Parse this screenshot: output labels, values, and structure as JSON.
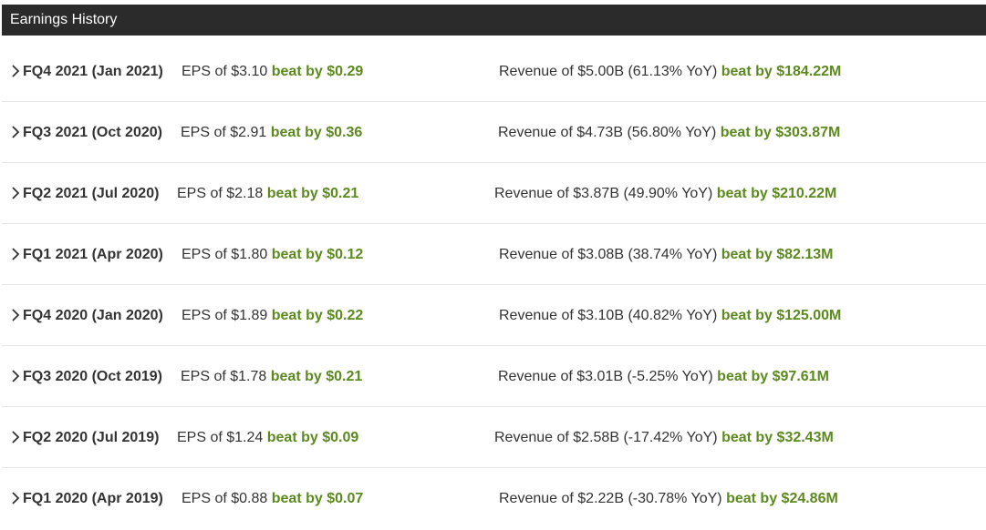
{
  "header": {
    "title": "Earnings History"
  },
  "colors": {
    "header_bg": "#2b2b2b",
    "beat_green": "#5c8a1e",
    "text": "#333333"
  },
  "rows": [
    {
      "period": "FQ4 2021 (Jan 2021)",
      "eps": "EPS of $3.10",
      "eps_beat": "beat by $0.29",
      "revenue": "Revenue of $5.00B (61.13% YoY)",
      "rev_beat": "beat by $184.22M"
    },
    {
      "period": "FQ3 2021 (Oct 2020)",
      "eps": "EPS of $2.91",
      "eps_beat": "beat by $0.36",
      "revenue": "Revenue of $4.73B (56.80% YoY)",
      "rev_beat": "beat by $303.87M"
    },
    {
      "period": "FQ2 2021 (Jul 2020)",
      "eps": "EPS of $2.18",
      "eps_beat": "beat by $0.21",
      "revenue": "Revenue of $3.87B (49.90% YoY)",
      "rev_beat": "beat by $210.22M"
    },
    {
      "period": "FQ1 2021 (Apr 2020)",
      "eps": "EPS of $1.80",
      "eps_beat": "beat by $0.12",
      "revenue": "Revenue of $3.08B (38.74% YoY)",
      "rev_beat": "beat by $82.13M"
    },
    {
      "period": "FQ4 2020 (Jan 2020)",
      "eps": "EPS of $1.89",
      "eps_beat": "beat by $0.22",
      "revenue": "Revenue of $3.10B (40.82% YoY)",
      "rev_beat": "beat by $125.00M"
    },
    {
      "period": "FQ3 2020 (Oct 2019)",
      "eps": "EPS of $1.78",
      "eps_beat": "beat by $0.21",
      "revenue": "Revenue of $3.01B (-5.25% YoY)",
      "rev_beat": "beat by $97.61M"
    },
    {
      "period": "FQ2 2020 (Jul 2019)",
      "eps": "EPS of $1.24",
      "eps_beat": "beat by $0.09",
      "revenue": "Revenue of $2.58B (-17.42% YoY)",
      "rev_beat": "beat by $32.43M"
    },
    {
      "period": "FQ1 2020 (Apr 2019)",
      "eps": "EPS of $0.88",
      "eps_beat": "beat by $0.07",
      "revenue": "Revenue of $2.22B (-30.78% YoY)",
      "rev_beat": "beat by $24.86M"
    }
  ]
}
